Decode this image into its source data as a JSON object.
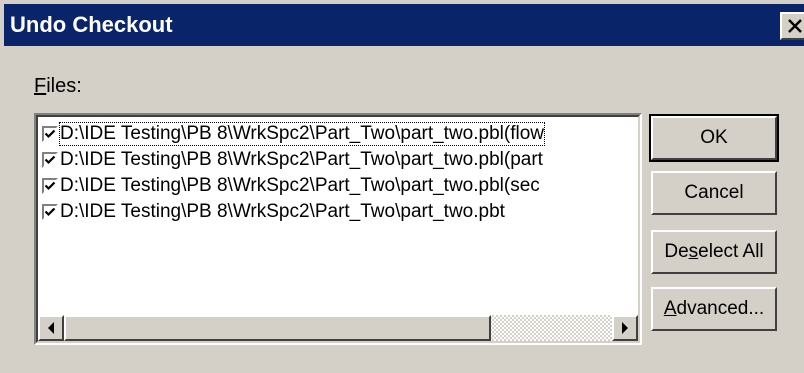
{
  "window": {
    "title": "Undo Checkout",
    "close_icon": "close-icon"
  },
  "files_label": {
    "mnemonic": "F",
    "rest": "iles:"
  },
  "files": [
    {
      "path": "D:\\IDE Testing\\PB 8\\WrkSpc2\\Part_Two\\part_two.pbl(flow",
      "checked": true
    },
    {
      "path": "D:\\IDE Testing\\PB 8\\WrkSpc2\\Part_Two\\part_two.pbl(part",
      "checked": true
    },
    {
      "path": "D:\\IDE Testing\\PB 8\\WrkSpc2\\Part_Two\\part_two.pbl(sec",
      "checked": true
    },
    {
      "path": "D:\\IDE Testing\\PB 8\\WrkSpc2\\Part_Two\\part_two.pbt",
      "checked": true
    }
  ],
  "scrollbar": {
    "left_icon": "arrow-left-icon",
    "right_icon": "arrow-right-icon",
    "position": 0.0,
    "visible_fraction": 0.78
  },
  "buttons": {
    "ok": "OK",
    "cancel": "Cancel",
    "deselect_pre": "De",
    "deselect_mnemonic": "s",
    "deselect_post": "elect All",
    "advanced_mnemonic": "A",
    "advanced_post": "dvanced..."
  },
  "colors": {
    "title_bar": "#0a246a",
    "dialog_bg": "#d4d0c8"
  }
}
